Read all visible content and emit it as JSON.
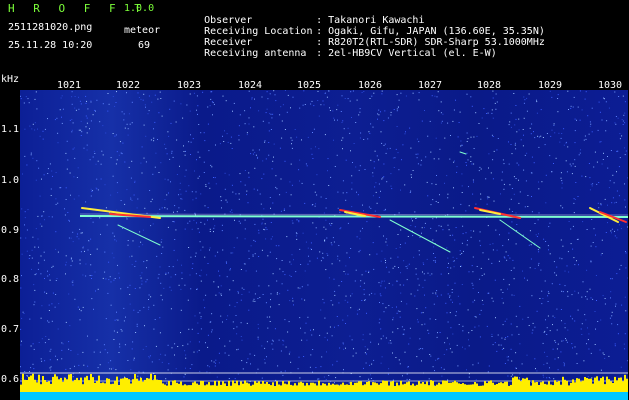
{
  "header": {
    "app_title": "H R O F F T",
    "app_version": "1.0.0",
    "filename": "2511281020.png",
    "datetime": "25.11.28 10:20",
    "meteor_label": "meteor",
    "meteor_count": "69",
    "info": [
      {
        "label": "Observer",
        "value": ": Takanori Kawachi"
      },
      {
        "label": "Receiving Location",
        "value": ": Ogaki, Gifu, JAPAN (136.60E, 35.35N)"
      },
      {
        "label": "Receiver",
        "value": ": R820T2(RTL-SDR) SDR-Sharp 53.1000MHz"
      },
      {
        "label": "Receiving antenna",
        "value": ": 2el-HB9CV Vertical (el. E-W)"
      }
    ]
  },
  "colors": {
    "text_green": "#7CFF3A",
    "text_white": "#ffffff",
    "background": "#0a1a8c",
    "echo": "#7fffd0",
    "noise_bar": "#ffee00",
    "base_band": "#00c8ff"
  },
  "axes": {
    "y_unit": "kHz",
    "x_ticks": [
      "1021",
      "1022",
      "1023",
      "1024",
      "1025",
      "1026",
      "1027",
      "1028",
      "1029",
      "1030"
    ],
    "y_ticks": [
      "1.1",
      "1.0",
      "0.9",
      "0.8",
      "0.7",
      "0.6"
    ]
  }
}
